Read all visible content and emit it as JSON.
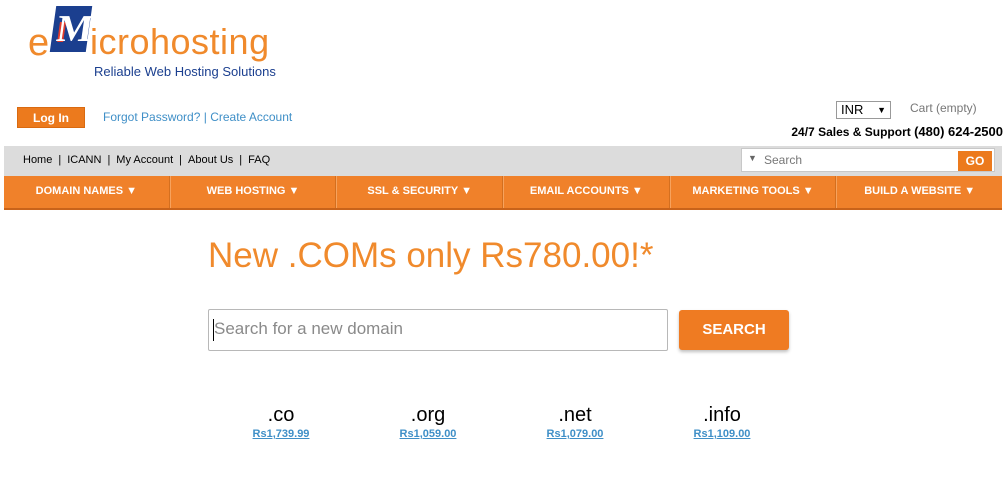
{
  "logo": {
    "e": "e",
    "m": "M",
    "rest": "icrohosting",
    "tagline": "Reliable Web Hosting Solutions"
  },
  "header": {
    "login_label": "Log In",
    "forgot_password": "Forgot Password?",
    "separator": " | ",
    "create_account": "Create Account",
    "currency": "INR",
    "cart": "Cart (empty)",
    "support_label": "24/7 Sales & Support ",
    "support_phone": "(480) 624-2500"
  },
  "top_nav": {
    "items": [
      "Home",
      "ICANN",
      "My Account",
      "About Us",
      "FAQ"
    ],
    "search_placeholder": "Search",
    "go_label": "GO"
  },
  "main_nav": {
    "items": [
      "DOMAIN NAMES ▼",
      "WEB HOSTING ▼",
      "SSL & SECURITY ▼",
      "EMAIL ACCOUNTS ▼",
      "MARKETING TOOLS ▼",
      "BUILD A WEBSITE ▼"
    ]
  },
  "promo": {
    "headline": "New .COMs only Rs780.00!*",
    "search_placeholder": "Search for a new domain",
    "search_label": "SEARCH"
  },
  "tlds": [
    {
      "ext": ".co",
      "price": "Rs1,739.99"
    },
    {
      "ext": ".org",
      "price": "Rs1,059.00"
    },
    {
      "ext": ".net",
      "price": "Rs1,079.00"
    },
    {
      "ext": ".info",
      "price": "Rs1,109.00"
    }
  ],
  "colors": {
    "accent": "#f08a2c",
    "brand_blue": "#1b3f8f",
    "link": "#3f8fc7"
  }
}
